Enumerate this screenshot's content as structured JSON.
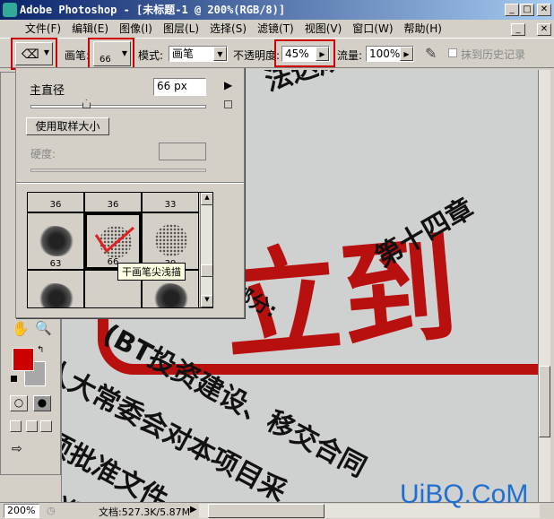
{
  "window": {
    "title": "Adobe Photoshop - [未标题-1 @ 200%(RGB/8)]"
  },
  "menu": [
    "文件(F)",
    "编辑(E)",
    "图像(I)",
    "图层(L)",
    "选择(S)",
    "滤镜(T)",
    "视图(V)",
    "窗口(W)",
    "帮助(H)"
  ],
  "options": {
    "brush_label": "画笔:",
    "brush_size": "66",
    "mode_label": "模式:",
    "mode_value": "画笔",
    "opacity_label": "不透明度:",
    "opacity_value": "45%",
    "flow_label": "流量:",
    "flow_value": "100%",
    "erase_history_label": "抹到历史记录",
    "erase_history_checked": false
  },
  "brush_popup": {
    "master_diameter_label": "主直径",
    "master_diameter_value": "66 px",
    "diameter_fraction": 0.33,
    "use_sample_size": "使用取样大小",
    "hardness_label": "硬度:",
    "hardness_value": "",
    "brushes": [
      {
        "size": "36"
      },
      {
        "size": "36"
      },
      {
        "size": "33"
      },
      {
        "size": "63",
        "type": "blob"
      },
      {
        "size": "66",
        "type": "spray",
        "selected": true
      },
      {
        "size": "39",
        "type": "spray"
      }
    ],
    "tooltip": "干画笔尖浅描"
  },
  "toolbox": {
    "foreground_color": "#cc0000",
    "background_color": "#a8a8a8"
  },
  "canvas": {
    "lines": [
      "法达成一致意见，由",
      "第十四章",
      "部分:",
      "(BT投资建设、移交合同",
      "人大常委会对本项目采",
      "项批准文件",
      "批准"
    ],
    "stamp_text": "立到"
  },
  "status": {
    "zoom": "200%",
    "doc_info": "文档:527.3K/5.87M"
  },
  "watermark": "UiBQ.CoM"
}
